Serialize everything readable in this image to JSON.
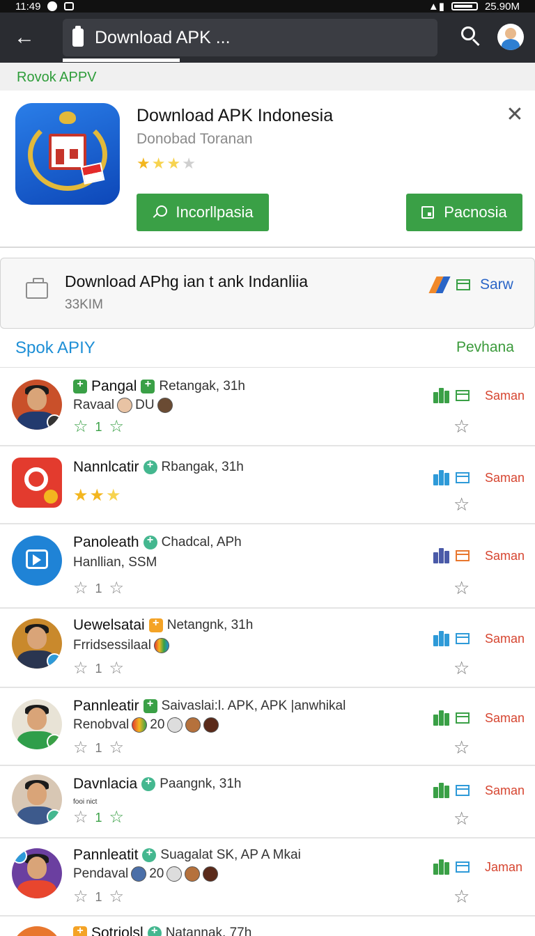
{
  "status": {
    "time": "11:49",
    "right": "25.90M"
  },
  "appbar": {
    "search_text": "Download APK ..."
  },
  "featured": {
    "section_label": "Rovok APPV",
    "title": "Download APK Indonesia",
    "subtitle": "Donobad Toranan",
    "rating": 2.5,
    "install_label": "Incorllpasia",
    "open_label": "Pacnosia"
  },
  "download": {
    "title": "Download APhg ian t ank Indanliia",
    "size": "33KIM",
    "save_label": "Sarw"
  },
  "list": {
    "title": "Spok APIY",
    "action": "Pevhana",
    "items": [
      {
        "name": "Pangal",
        "meta": "Retangak, 31h",
        "sub": "Ravaal",
        "sub_extra": "DU",
        "rating": "1",
        "action": "Saman"
      },
      {
        "name": "Nannlcatir",
        "meta": "Rbangak, 31h",
        "sub": "",
        "sub_extra": "",
        "rating": "",
        "action": "Saman"
      },
      {
        "name": "Panoleath",
        "meta": "Chadcal, APh",
        "sub": "Hanllian, SSM",
        "sub_extra": "",
        "rating": "1",
        "action": "Saman"
      },
      {
        "name": "Uewelsatai",
        "meta": "Netangnk, 31h",
        "sub": "Frridsessilaal",
        "sub_extra": "",
        "rating": "1",
        "action": "Saman"
      },
      {
        "name": "Pannleatir",
        "meta": "Saivaslai:l. APK, APK |anwhikal",
        "sub": "Renobval",
        "sub_extra": "20",
        "rating": "1",
        "action": "Saman"
      },
      {
        "name": "Davnlacia",
        "meta": "Paangnk, 31h",
        "sub": "fooi nict",
        "sub_extra": "",
        "rating": "1",
        "action": "Saman"
      },
      {
        "name": "Pannleatit",
        "meta": "Suagalat SK, AP A Mkai",
        "sub": "Pendaval",
        "sub_extra": "20",
        "rating": "1",
        "action": "Jaman"
      },
      {
        "name": "Sotriolsl",
        "meta": "Natannak, 77h",
        "sub": "",
        "sub_extra": "",
        "rating": "",
        "action": ""
      }
    ]
  },
  "colors": {
    "accent_green": "#3aa046",
    "accent_blue": "#1e8fd6",
    "action_red": "#d64530",
    "appbar": "#2a2c31"
  }
}
